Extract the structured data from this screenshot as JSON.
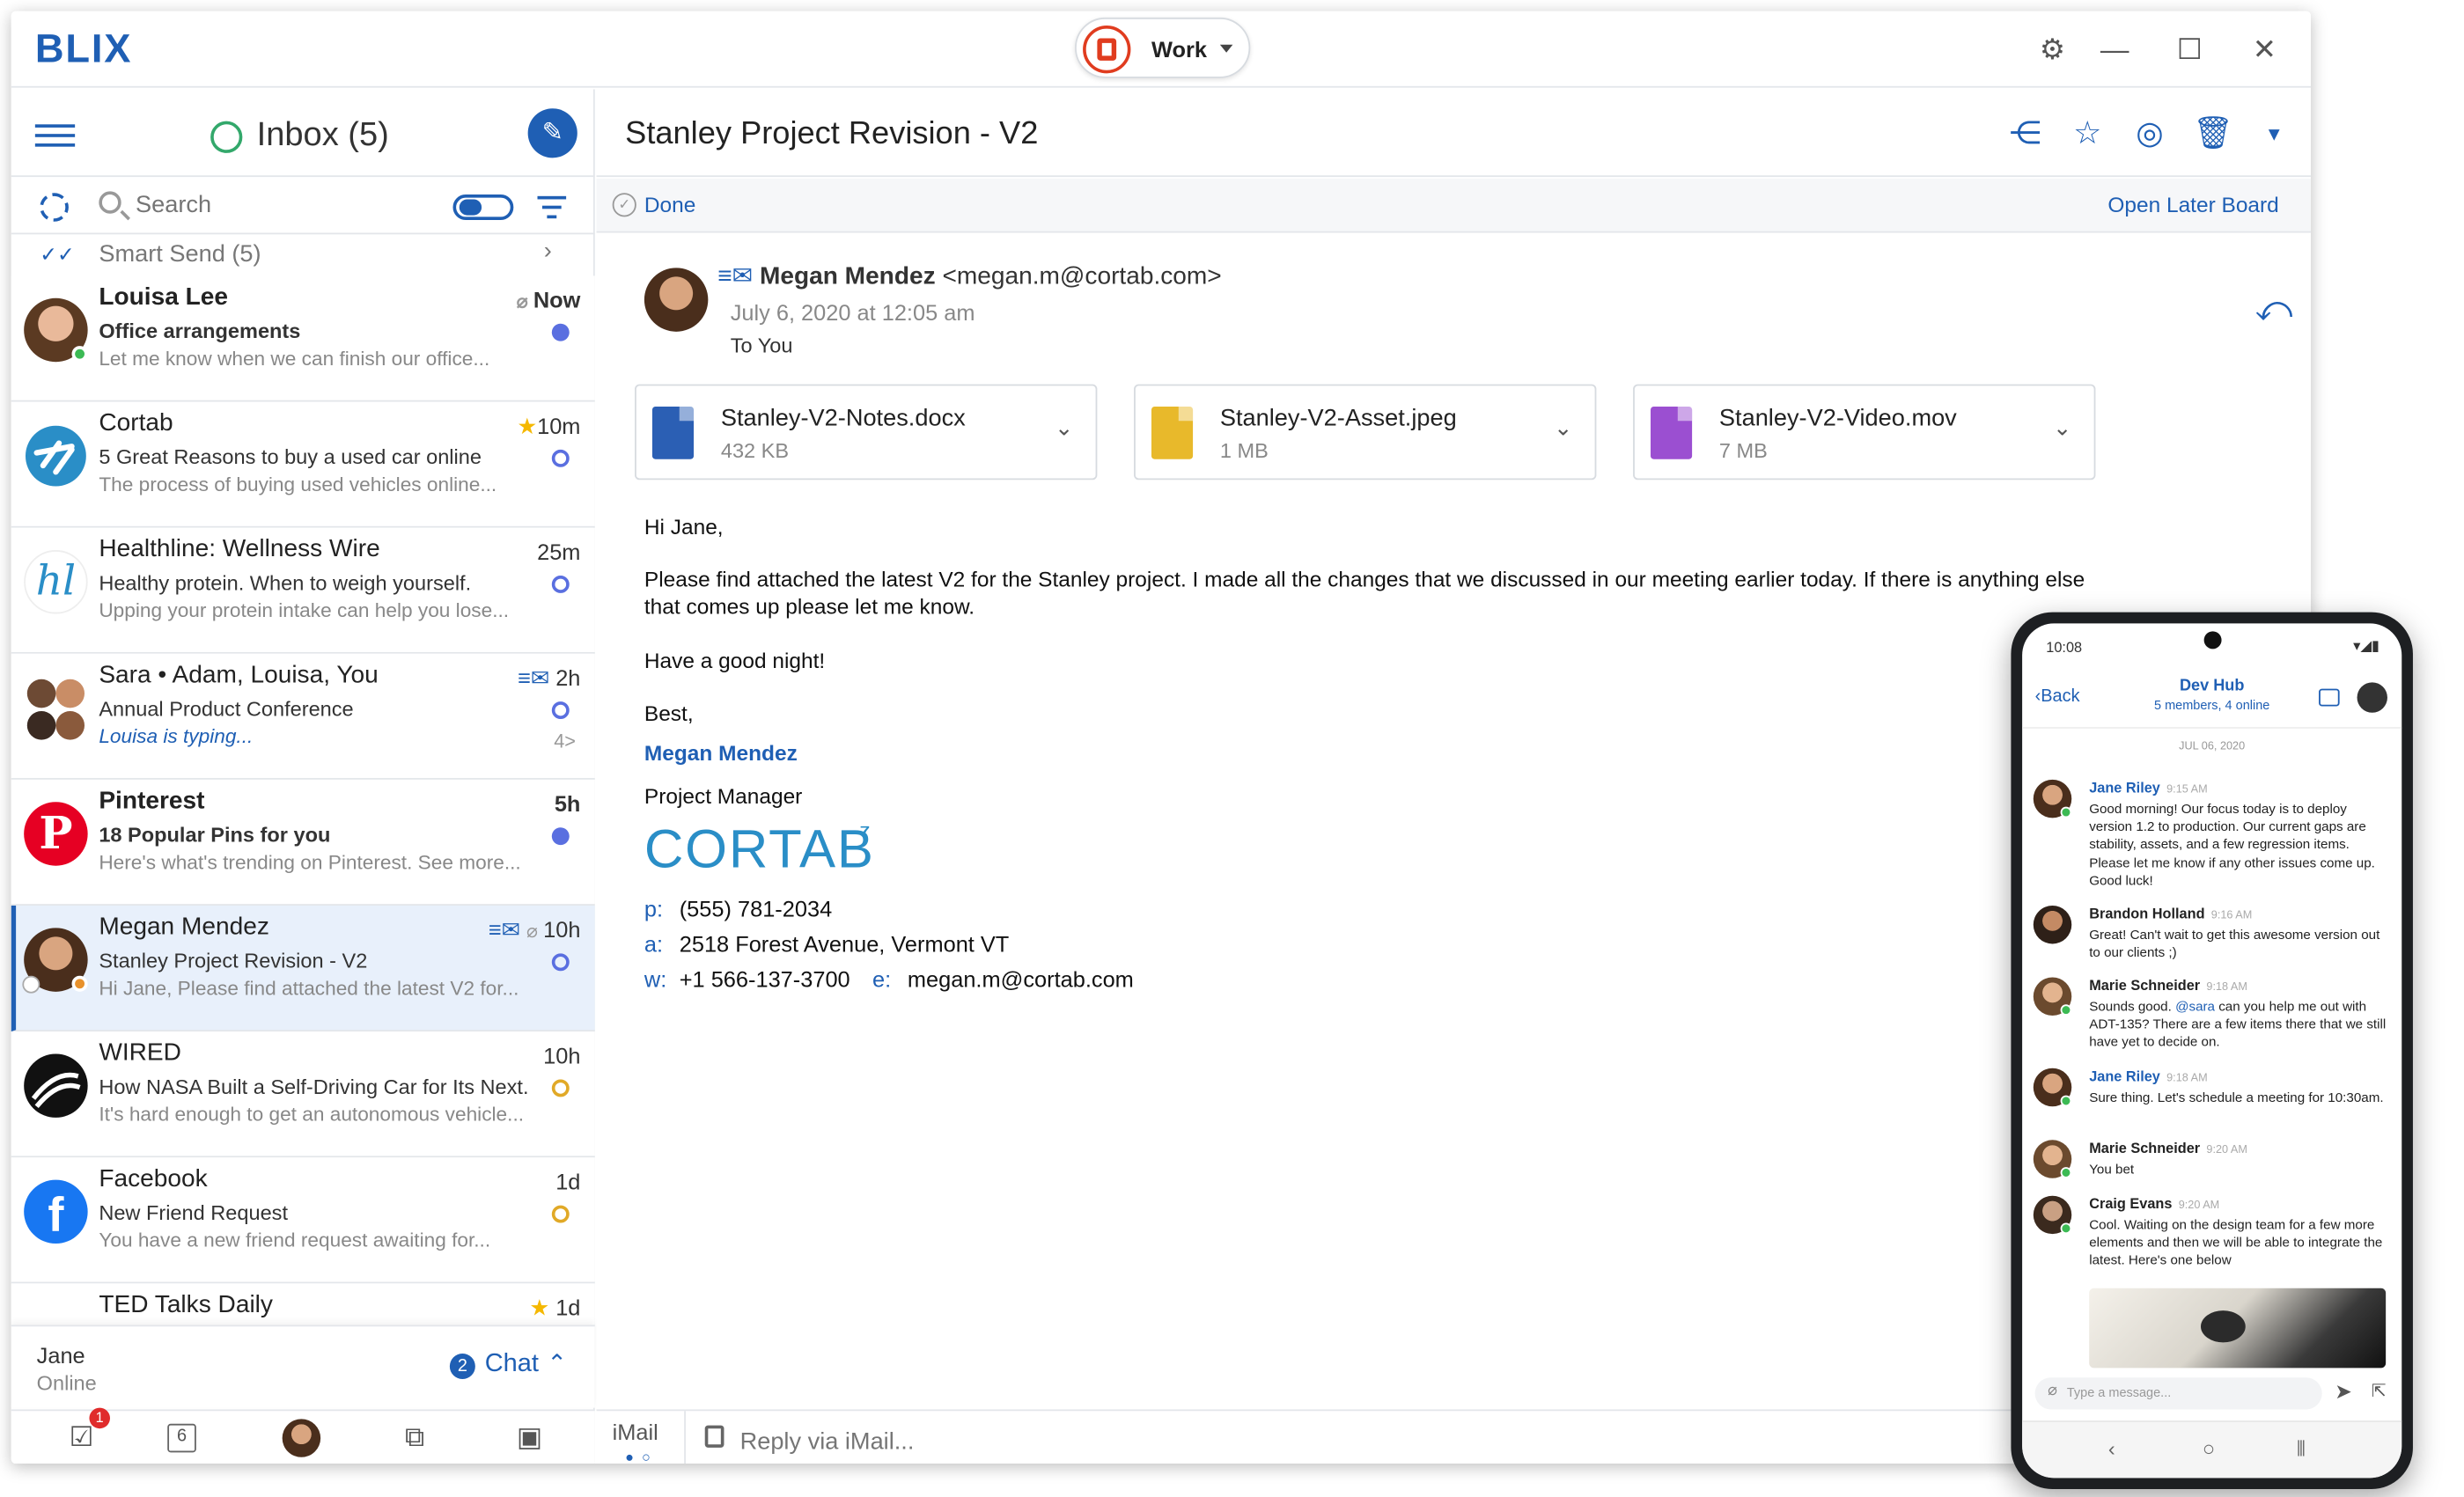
{
  "app": {
    "logo": "BLIX"
  },
  "account": {
    "label": "Work"
  },
  "window_controls": {
    "settings": "⚙",
    "minimize": "—",
    "maximize": "☐",
    "close": "✕"
  },
  "sidebar": {
    "inbox_title": "Inbox (5)",
    "search_placeholder": "Search",
    "smart_send": "Smart Send (5)",
    "emails": [
      {
        "from": "Louisa Lee",
        "subject": "Office arrangements",
        "preview": "Let me know when we can finish our office...",
        "time": "Now",
        "unread": true,
        "attachment": true
      },
      {
        "from": "Cortab",
        "subject": "5 Great Reasons to buy a used car online",
        "preview": "The process of buying used vehicles online...",
        "time": "10m",
        "starred": true
      },
      {
        "from": "Healthline: Wellness Wire",
        "subject": "Healthy protein. When to weigh yourself.",
        "preview": "Upping your protein intake can help you lose...",
        "time": "25m"
      },
      {
        "from": "Sara • Adam, Louisa, You",
        "subject": "Annual Product Conference",
        "preview": "Louisa is typing...",
        "time": "2h",
        "count": "4>"
      },
      {
        "from": "Pinterest",
        "subject": "18 Popular Pins for you",
        "preview": "Here's what's trending on Pinterest. See more...",
        "time": "5h",
        "unread": true
      },
      {
        "from": "Megan Mendez",
        "subject": "Stanley Project Revision - V2",
        "preview": "Hi Jane, Please find attached the latest V2 for...",
        "time": "10h",
        "selected": true
      },
      {
        "from": "WIRED",
        "subject": "How NASA Built a Self-Driving Car for Its Next...",
        "preview": "It's hard enough to get an autonomous vehicle...",
        "time": "10h"
      },
      {
        "from": "Facebook",
        "subject": "New Friend Request",
        "preview": "You have a new friend request awaiting for...",
        "time": "1d"
      },
      {
        "from": "TED Talks Daily",
        "subject": "",
        "preview": "",
        "time": "1d",
        "starred": true
      }
    ],
    "chat": {
      "user": "Jane",
      "status": "Online",
      "badge": "2",
      "label": "Chat"
    },
    "dock_badge": "1",
    "dock_calendar_day": "6"
  },
  "email": {
    "title": "Stanley Project Revision - V2",
    "done_label": "Done",
    "later_board": "Open Later Board",
    "from_name": "Megan Mendez",
    "from_email": "<megan.m@cortab.com>",
    "date": "July 6, 2020 at 12:05 am",
    "to": "To You",
    "attachments": [
      {
        "name": "Stanley-V2-Notes.docx",
        "size": "432 KB",
        "color": "#2b5fb4"
      },
      {
        "name": "Stanley-V2-Asset.jpeg",
        "size": "1 MB",
        "color": "#e8b92b"
      },
      {
        "name": "Stanley-V2-Video.mov",
        "size": "7 MB",
        "color": "#9b4fd1"
      }
    ],
    "greeting": "Hi Jane,",
    "body_line1": "Please find attached the latest V2 for the Stanley project. I made all the changes that we discussed in our meeting earlier today. If there is anything else",
    "body_line2": "that comes up please let me know.",
    "closing": "Have a good night!",
    "signoff": "Best,",
    "sig_name": "Megan Mendez",
    "sig_title": "Project Manager",
    "company": "CORTAB",
    "phone_k": "p:",
    "phone": "(555) 781-2034",
    "addr_k": "a:",
    "addr": "2518  Forest Avenue, Vermont VT",
    "web_k": "w:",
    "web": "+1 566-137-3700",
    "email_k": "e:",
    "email": "megan.m@cortab.com"
  },
  "reply": {
    "imail": "iMail",
    "placeholder": "Reply via iMail..."
  },
  "phone": {
    "time": "10:08",
    "back": "Back",
    "group": "Dev Hub",
    "group_sub": "5 members, 4 online",
    "date": "JUL 06, 2020",
    "input_placeholder": "Type a message...",
    "messages": [
      {
        "name": "Jane Riley",
        "time": "9:15 AM",
        "text": "Good morning! Our focus today is to deploy version 1.2 to production. Our current gaps are stability, assets, and a few regression items. Please let me know if any other issues come up. Good luck!"
      },
      {
        "name": "Brandon Holland",
        "time": "9:16 AM",
        "text": "Great! Can't wait to get this awesome version out to our clients ;)"
      },
      {
        "name": "Marie Schneider",
        "time": "9:18 AM",
        "text_pre": "Sounds good. ",
        "mention": "@sara",
        "text_post": " can you help me out with ADT-135? There are a few items there that we still have yet to decide on."
      },
      {
        "name": "Jane Riley",
        "time": "9:18 AM",
        "text": "Sure thing. Let's schedule a meeting for 10:30am."
      },
      {
        "name": "Marie Schneider",
        "time": "9:20 AM",
        "text": "You bet"
      },
      {
        "name": "Craig Evans",
        "time": "9:20 AM",
        "text": "Cool. Waiting on the design team for a few more elements and then we will be able to integrate the latest. Here's one below"
      }
    ]
  }
}
